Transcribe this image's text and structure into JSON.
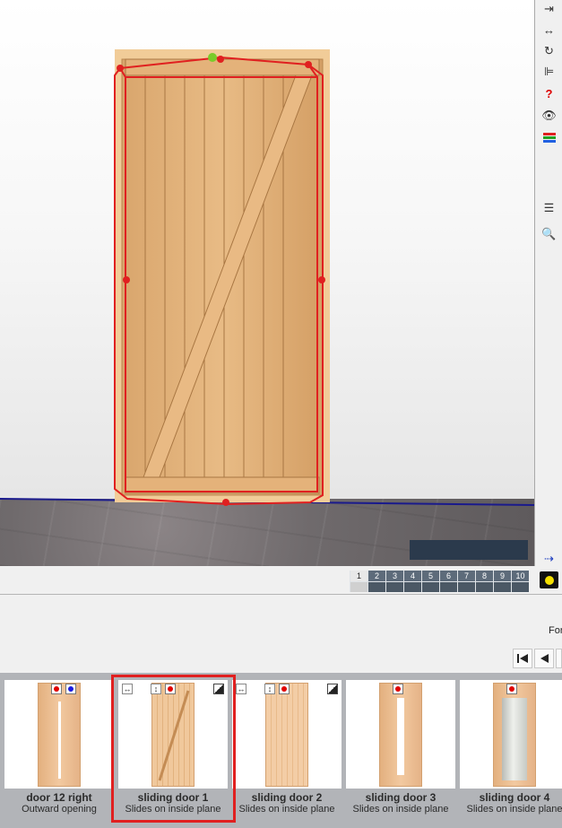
{
  "toolbar": {
    "tools": [
      {
        "icon": "exit-arrow-icon",
        "glyph": "⇥"
      },
      {
        "icon": "resize-horizontal-icon",
        "glyph": "↔"
      },
      {
        "icon": "rotate-icon",
        "glyph": "↻"
      },
      {
        "icon": "align-icon",
        "glyph": "⊫"
      },
      {
        "icon": "dimension-help-icon",
        "glyph": "?"
      },
      {
        "icon": "eye-icon",
        "glyph": "👁"
      },
      {
        "icon": "color-bars-icon",
        "glyph": "≡"
      },
      {
        "icon": "list-icon",
        "glyph": "☰"
      },
      {
        "icon": "magnifier-icon",
        "glyph": "🔍"
      },
      {
        "icon": "import-arrow-icon",
        "glyph": "⇢"
      },
      {
        "icon": "light-bulb-icon",
        "glyph": "●"
      }
    ]
  },
  "pages": [
    "1",
    "2",
    "3",
    "4",
    "5",
    "6",
    "7",
    "8",
    "9",
    "10"
  ],
  "active_page": "1",
  "for_label": "For",
  "catalog": {
    "items": [
      {
        "name": "door 12 right",
        "subtitle": "Outward opening"
      },
      {
        "name": "sliding door 1",
        "subtitle": "Slides on inside plane"
      },
      {
        "name": "sliding door 2",
        "subtitle": "Slides on inside plane"
      },
      {
        "name": "sliding door 3",
        "subtitle": "Slides on inside plane"
      },
      {
        "name": "sliding door 4",
        "subtitle": "Slides on inside plane"
      }
    ],
    "selected_index": 1
  },
  "colors": {
    "selection": "#e02020",
    "floor_line": "#1a1a8c",
    "door_wood": "#e2b27c",
    "grip_green": "#7acb2a"
  }
}
